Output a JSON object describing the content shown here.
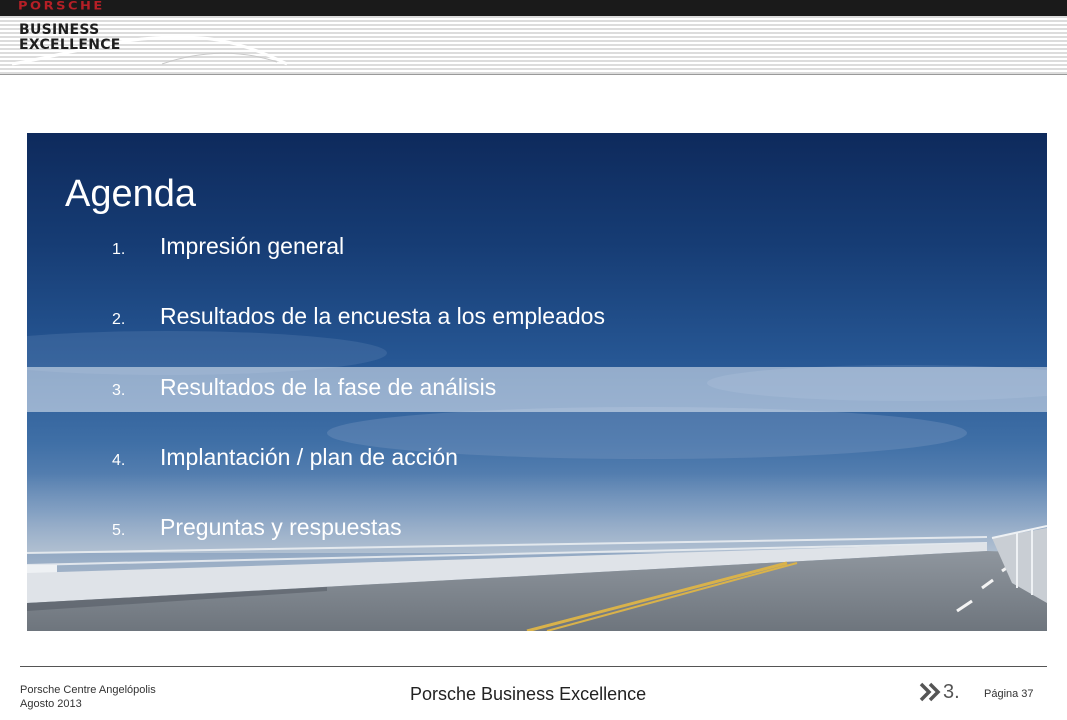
{
  "header": {
    "brand": "PORSCHE",
    "logo_line1": "BUSINESS",
    "logo_line2": "EXCELLENCE"
  },
  "agenda": {
    "title": "Agenda",
    "highlighted_index": 3,
    "items": [
      {
        "number": "1.",
        "label": "Impresión general"
      },
      {
        "number": "2.",
        "label": "Resultados de la encuesta a los empleados"
      },
      {
        "number": "3.",
        "label": "Resultados de la fase de análisis"
      },
      {
        "number": "4.",
        "label": "Implantación / plan de acción"
      },
      {
        "number": "5.",
        "label": "Preguntas y respuestas"
      }
    ]
  },
  "footer": {
    "dealer": "Porsche Centre  Angelópolis",
    "date": "Agosto 2013",
    "center_title": "Porsche Business Excellence",
    "section": "3.",
    "page_label": "Página 37"
  },
  "colors": {
    "brand_red": "#b51f26",
    "sky_dark": "#0e2a5c",
    "highlight": "#ebf0f8"
  },
  "icons": [
    "double-chevron-right-icon"
  ]
}
